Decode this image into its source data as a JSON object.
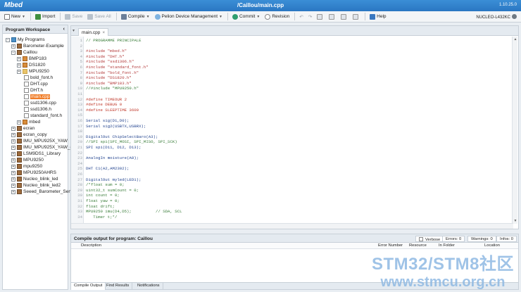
{
  "app": {
    "logo": "Mbed",
    "path": "/Caillou/main.cpp",
    "version": "1.10.25.0"
  },
  "toolbar": {
    "new": "New",
    "import": "Import",
    "save": "Save",
    "save_all": "Save All",
    "compile": "Compile",
    "pelion": "Pelion Device Management",
    "commit": "Commit",
    "revision": "Revision",
    "help": "Help",
    "board": "NUCLEO-L432KC"
  },
  "workspace": {
    "title": "Program Workspace",
    "collapse_icon": "chevron-left-icon",
    "root": "My Programs",
    "items": [
      {
        "label": "Barometer-Example",
        "type": "prog"
      },
      {
        "label": "Caillou",
        "type": "prog"
      },
      {
        "label": "BMP183",
        "type": "lib"
      },
      {
        "label": "DS1820",
        "type": "lib"
      },
      {
        "label": "MPU9250",
        "type": "folder"
      },
      {
        "label": "bold_font.h",
        "type": "file"
      },
      {
        "label": "DHT.cpp",
        "type": "file"
      },
      {
        "label": "DHT.h",
        "type": "file"
      },
      {
        "label": "main.cpp",
        "type": "file"
      },
      {
        "label": "ssd1306.cpp",
        "type": "file"
      },
      {
        "label": "ssd1306.h",
        "type": "file"
      },
      {
        "label": "standard_font.h",
        "type": "file"
      },
      {
        "label": "mbed",
        "type": "lib"
      },
      {
        "label": "ecran",
        "type": "prog"
      },
      {
        "label": "ecran_copy",
        "type": "prog"
      },
      {
        "label": "IMU_MPU925X_YAW",
        "type": "prog"
      },
      {
        "label": "IMU_MPU925X_YAW_co",
        "type": "prog"
      },
      {
        "label": "LSM9DS1_Library",
        "type": "prog"
      },
      {
        "label": "MPU9250",
        "type": "prog"
      },
      {
        "label": "mpu9250",
        "type": "prog"
      },
      {
        "label": "MPU9250AHRS",
        "type": "prog"
      },
      {
        "label": "Nucleo_blink_led",
        "type": "prog"
      },
      {
        "label": "Nucleo_blink_led2",
        "type": "prog"
      },
      {
        "label": "Seeed_Barometer_Sensc",
        "type": "prog"
      }
    ]
  },
  "editor": {
    "tab": "main.cpp",
    "lines": [
      {
        "n": "1",
        "t": "// PROGRAMME PRINCIPALE",
        "k": "com"
      },
      {
        "n": "2",
        "t": "",
        "k": "code"
      },
      {
        "n": "3",
        "t": "#include \"mbed.h\"",
        "k": "pre"
      },
      {
        "n": "4",
        "t": "#include \"DHT.h\"",
        "k": "pre"
      },
      {
        "n": "5",
        "t": "#include \"ssd1306.h\"",
        "k": "pre"
      },
      {
        "n": "6",
        "t": "#include \"standard_font.h\"",
        "k": "pre"
      },
      {
        "n": "7",
        "t": "#include \"bold_font.h\"",
        "k": "pre"
      },
      {
        "n": "8",
        "t": "#include \"DS1820.h\"",
        "k": "pre"
      },
      {
        "n": "9",
        "t": "#include \"BMP183.h\"",
        "k": "pre"
      },
      {
        "n": "10",
        "t": "//#include \"MPU9250.h\"",
        "k": "com"
      },
      {
        "n": "11",
        "t": "",
        "k": "code"
      },
      {
        "n": "12",
        "t": "#define TIMEOUR 2",
        "k": "def"
      },
      {
        "n": "13",
        "t": "#define DEBUG 0",
        "k": "def"
      },
      {
        "n": "14",
        "t": "#define SLEEPTIME 3600",
        "k": "def"
      },
      {
        "n": "15",
        "t": "",
        "k": "code"
      },
      {
        "n": "16",
        "t": "Serial sig(D1,D0);",
        "k": "code"
      },
      {
        "n": "17",
        "t": "Serial sig2(USBTX,USBRX);",
        "k": "code"
      },
      {
        "n": "18",
        "t": "",
        "k": "code"
      },
      {
        "n": "19",
        "t": "DigitalOut ChipSelectBaro(A3);",
        "k": "code"
      },
      {
        "n": "20",
        "t": "//SPI spi(SPI_MOSI, SPI_MISO, SPI_SCK)",
        "k": "com"
      },
      {
        "n": "21",
        "t": "SPI spi(D11, D12, D13);",
        "k": "code"
      },
      {
        "n": "22",
        "t": "",
        "k": "code"
      },
      {
        "n": "23",
        "t": "AnalogIn moisture(A0);",
        "k": "code"
      },
      {
        "n": "24",
        "t": "",
        "k": "code"
      },
      {
        "n": "25",
        "t": "DHT C1(A2,AM2302);",
        "k": "code"
      },
      {
        "n": "26",
        "t": "",
        "k": "code"
      },
      {
        "n": "27",
        "t": "DigitalOut myled(LED1);",
        "k": "code"
      },
      {
        "n": "28",
        "t": "/*float sum = 0;",
        "k": "com"
      },
      {
        "n": "29",
        "t": "uint32_t sumCount = 0;",
        "k": "com"
      },
      {
        "n": "30",
        "t": "int count = 0;",
        "k": "com"
      },
      {
        "n": "31",
        "t": "float yaw = 0;",
        "k": "com"
      },
      {
        "n": "32",
        "t": "float drift;",
        "k": "com"
      },
      {
        "n": "33",
        "t": "MPU9250 imu(D4,D5);          // SDA, SCL",
        "k": "com"
      },
      {
        "n": "34",
        "t": "   Timer t;*/",
        "k": "com"
      }
    ]
  },
  "compile": {
    "title": "Compile output for program: Caillou",
    "verbose": "Verbose",
    "errors": "Errors: 0",
    "warnings": "Warnings: 0",
    "infos": "Infos: 0",
    "columns": [
      "Description",
      "Error Number",
      "Resource",
      "In Folder",
      "Location"
    ],
    "tabs": [
      "Compile Output",
      "Find Results",
      "Notifications"
    ]
  },
  "watermark": {
    "line1": "STM32/STM8社区",
    "line2": "www.stmcu.org.cn"
  },
  "colors": {
    "accent": "#2a77c2",
    "selected": "#f07d28"
  }
}
